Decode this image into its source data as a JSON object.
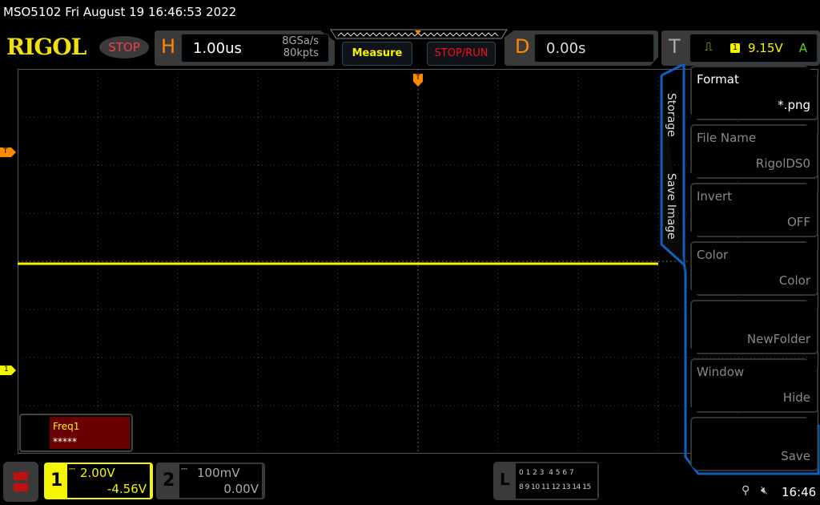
{
  "status_bar": {
    "title": "MSO5102  Fri August 19 16:46:53 2022"
  },
  "logo": "RIGOL",
  "run_state": "STOP",
  "horizontal": {
    "letter": "H",
    "timebase": "1.00us",
    "sample_rate": "8GSa/s",
    "memory_depth": "80kpts"
  },
  "buttons": {
    "measure": "Measure",
    "stop_run": "STOP/RUN"
  },
  "delay": {
    "letter": "D",
    "value": "0.00s"
  },
  "trigger": {
    "letter": "T",
    "source": "1",
    "level": "9.15V",
    "mode": "A",
    "marker": "T"
  },
  "channel1": {
    "number": "1",
    "scale": "2.00V",
    "offset": "-4.56V",
    "marker": "1",
    "color": "#f5f500"
  },
  "channel2": {
    "number": "2",
    "scale": "100mV",
    "offset": "0.00V"
  },
  "measurement": {
    "name": "Freq1",
    "value": "*****"
  },
  "logic": {
    "letter": "L",
    "row1": "0 1 2 3  4 5 6 7",
    "row2": "8 9 10 11 12 13 14 15"
  },
  "menu": {
    "tab_top": "Storage",
    "tab_bottom": "Save Image",
    "items": [
      {
        "label": "Format",
        "value": "*.png"
      },
      {
        "label": "File Name",
        "value": "RigolDS0"
      },
      {
        "label": "Invert",
        "value": "OFF"
      },
      {
        "label": "Color",
        "value": "Color"
      },
      {
        "label": "",
        "value": "NewFolder"
      },
      {
        "label": "Window",
        "value": "Hide"
      },
      {
        "label": "",
        "value": "Save"
      }
    ]
  },
  "system": {
    "time": "16:46"
  }
}
